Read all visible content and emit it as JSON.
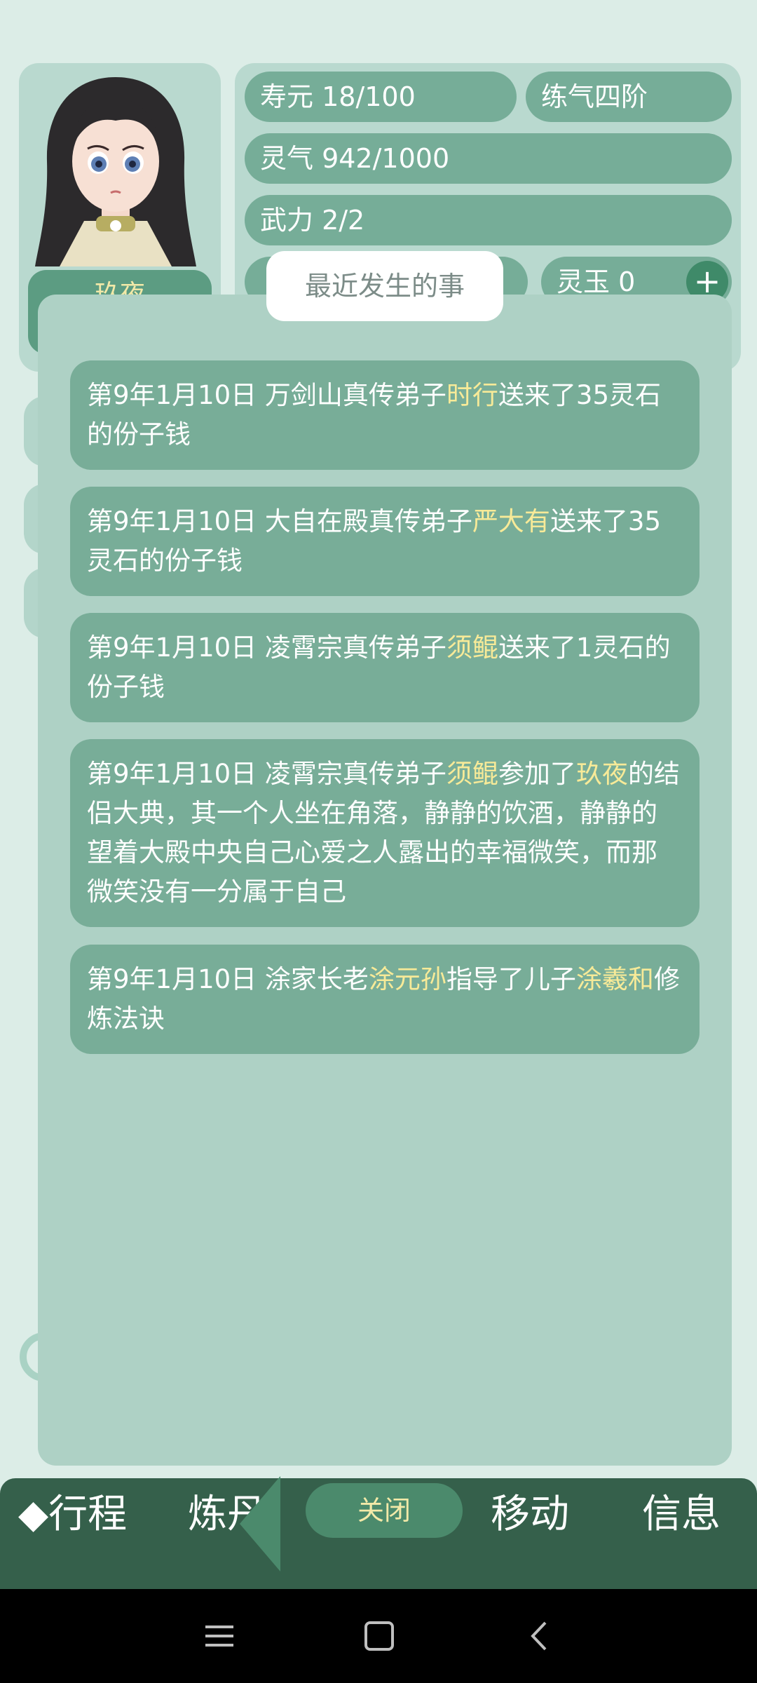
{
  "character": {
    "name": "玖夜"
  },
  "stats": {
    "lifespan": "寿元 18/100",
    "realm": "练气四阶",
    "spirit": "灵气 942/1000",
    "force": "武力 2/2",
    "jade": "灵玉 0",
    "plus_symbol": "+"
  },
  "modal": {
    "title": "最近发生的事",
    "events": [
      {
        "segments": [
          {
            "text": "第9年1月10日 万剑山真传弟子",
            "highlight": false
          },
          {
            "text": "时行",
            "highlight": true
          },
          {
            "text": "送来了35灵石的份子钱",
            "highlight": false
          }
        ]
      },
      {
        "segments": [
          {
            "text": "第9年1月10日 大自在殿真传弟子",
            "highlight": false
          },
          {
            "text": "严大有",
            "highlight": true
          },
          {
            "text": "送来了35灵石的份子钱",
            "highlight": false
          }
        ]
      },
      {
        "segments": [
          {
            "text": "第9年1月10日 凌霄宗真传弟子",
            "highlight": false
          },
          {
            "text": "须鲲",
            "highlight": true
          },
          {
            "text": "送来了1灵石的份子钱",
            "highlight": false
          }
        ]
      },
      {
        "segments": [
          {
            "text": "第9年1月10日 凌霄宗真传弟子",
            "highlight": false
          },
          {
            "text": "须鲲",
            "highlight": true
          },
          {
            "text": "参加了",
            "highlight": false
          },
          {
            "text": "玖夜",
            "highlight": true
          },
          {
            "text": "的结侣大典，其一个人坐在角落，静静的饮酒，静静的望着大殿中央自己心爱之人露出的幸福微笑，而那微笑没有一分属于自己",
            "highlight": false
          }
        ]
      },
      {
        "segments": [
          {
            "text": "第9年1月10日 涂家长老",
            "highlight": false
          },
          {
            "text": "涂元孙",
            "highlight": true
          },
          {
            "text": "指导了儿子",
            "highlight": false
          },
          {
            "text": "涂羲和",
            "highlight": true
          },
          {
            "text": "修炼法诀",
            "highlight": false
          }
        ]
      }
    ],
    "close_label": "关闭"
  },
  "bottom_nav": {
    "itinerary": "◆行程",
    "alchemy": "炼丹",
    "move": "移动",
    "info": "信息"
  },
  "colors": {
    "background": "#dcede7",
    "panel": "#aed1c5",
    "event_card": "#78ad98",
    "highlight_text": "#f7ea98",
    "nav_bar": "#35604b"
  }
}
